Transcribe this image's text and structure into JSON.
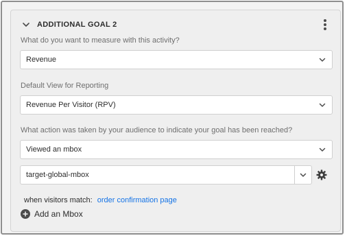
{
  "goal": {
    "title": "ADDITIONAL GOAL 2"
  },
  "measure": {
    "label": "What do you want to measure with this activity?",
    "value": "Revenue"
  },
  "reporting": {
    "label": "Default View for Reporting",
    "value": "Revenue Per Visitor (RPV)"
  },
  "action": {
    "label": "What action was taken by your audience to indicate your goal has been reached?",
    "value": "Viewed an mbox"
  },
  "mbox": {
    "value": "target-global-mbox"
  },
  "match": {
    "prefix": "when visitors match:",
    "link": "order confirmation page"
  },
  "add_mbox": {
    "label": "Add an Mbox"
  },
  "icons": {
    "collapse": "chevron-down-icon",
    "more": "more-vertical-icon",
    "dropdown": "chevron-down-icon",
    "settings": "gear-icon",
    "add": "add-circle-icon"
  },
  "colors": {
    "link": "#1473e6",
    "card_bg": "#efefef",
    "frame_border": "#8e8e8e"
  }
}
